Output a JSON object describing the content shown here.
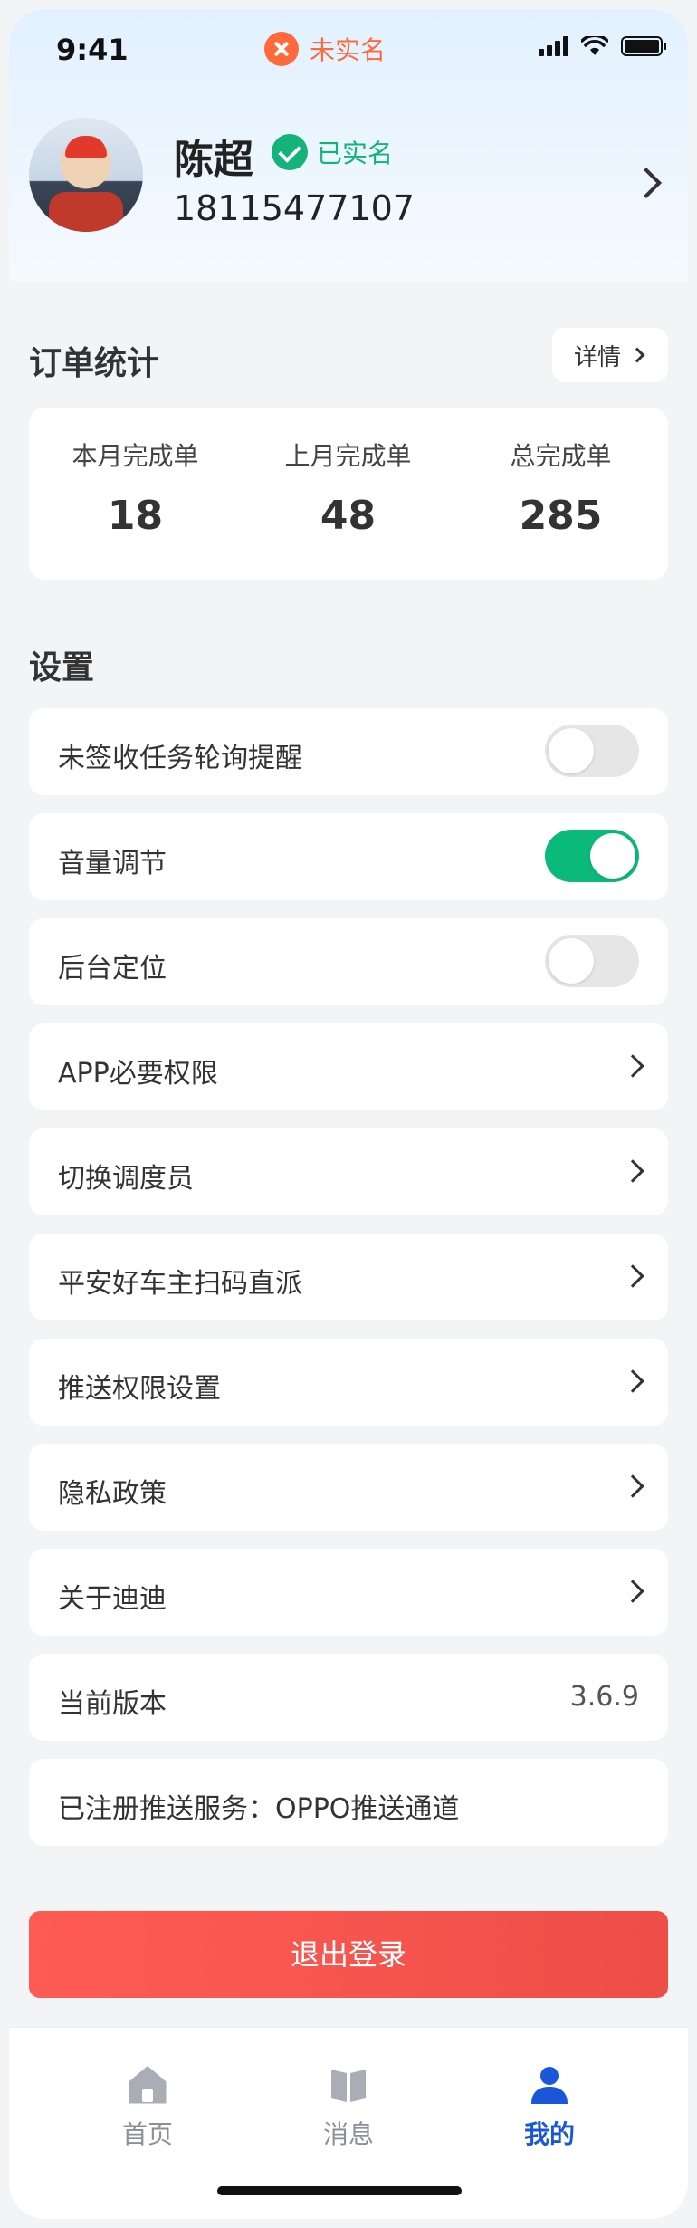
{
  "status_bar": {
    "time": "9:41",
    "realname_status": "未实名"
  },
  "profile": {
    "name": "陈超",
    "verified_label": "已实名",
    "phone": "18115477107"
  },
  "order_stats": {
    "title": "订单统计",
    "detail_label": "详情",
    "items": [
      {
        "label": "本月完成单",
        "value": "18"
      },
      {
        "label": "上月完成单",
        "value": "48"
      },
      {
        "label": "总完成单",
        "value": "285"
      }
    ]
  },
  "settings": {
    "title": "设置",
    "items": [
      {
        "label": "未签收任务轮询提醒",
        "type": "toggle",
        "on": false
      },
      {
        "label": "音量调节",
        "type": "toggle",
        "on": true
      },
      {
        "label": "后台定位",
        "type": "toggle",
        "on": false
      },
      {
        "label": "APP必要权限",
        "type": "link"
      },
      {
        "label": "切换调度员",
        "type": "link"
      },
      {
        "label": "平安好车主扫码直派",
        "type": "link"
      },
      {
        "label": "推送权限设置",
        "type": "link"
      },
      {
        "label": "隐私政策",
        "type": "link"
      },
      {
        "label": "关于迪迪",
        "type": "link"
      },
      {
        "label": "当前版本",
        "type": "value",
        "value": "3.6.9"
      },
      {
        "label": "已注册推送服务：OPPO推送通道",
        "type": "text"
      }
    ]
  },
  "logout_label": "退出登录",
  "tabbar": {
    "items": [
      {
        "label": "首页",
        "icon": "home-icon",
        "active": false
      },
      {
        "label": "消息",
        "icon": "book-icon",
        "active": false
      },
      {
        "label": "我的",
        "icon": "person-icon",
        "active": true
      }
    ]
  },
  "colors": {
    "accent_green": "#0bb97a",
    "accent_blue": "#1a57d8",
    "warning_orange": "#ff6a3d",
    "danger_red": "#f05450"
  }
}
